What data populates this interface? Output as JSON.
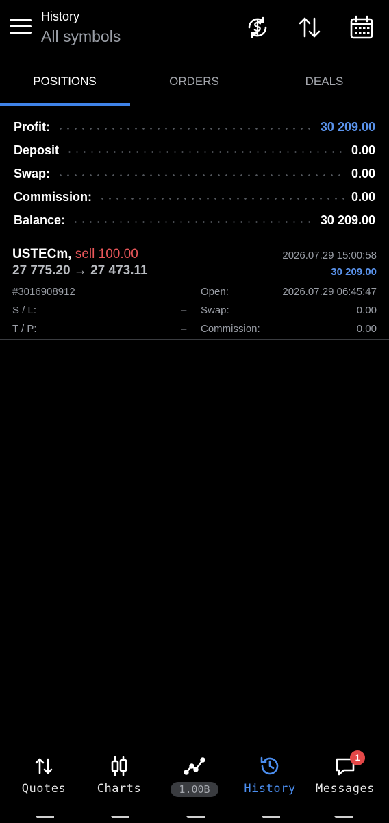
{
  "header": {
    "title": "History",
    "subtitle": "All symbols",
    "icons": [
      "currency-refresh-icon",
      "sort-icon",
      "calendar-icon"
    ]
  },
  "tabs": [
    {
      "label": "POSITIONS",
      "active": true
    },
    {
      "label": "ORDERS",
      "active": false
    },
    {
      "label": "DEALS",
      "active": false
    }
  ],
  "summary": [
    {
      "label": "Profit:",
      "value": "30 209.00",
      "highlight": true
    },
    {
      "label": "Deposit",
      "value": "0.00",
      "highlight": false
    },
    {
      "label": "Swap:",
      "value": "0.00",
      "highlight": false
    },
    {
      "label": "Commission:",
      "value": "0.00",
      "highlight": false
    },
    {
      "label": "Balance:",
      "value": "30 209.00",
      "highlight": false
    }
  ],
  "position": {
    "symbol": "USTECm,",
    "side": "sell 100.00",
    "close_time": "2026.07.29 15:00:58",
    "prices": "27 775.20 → 27 473.11",
    "profit": "30 209.00",
    "ticket": "#3016908912",
    "sl_label": "S / L:",
    "sl_value": "–",
    "tp_label": "T / P:",
    "tp_value": "–",
    "open_label": "Open:",
    "open_value": "2026.07.29 06:45:47",
    "swap_label": "Swap:",
    "swap_value": "0.00",
    "commission_label": "Commission:",
    "commission_value": "0.00"
  },
  "nav": {
    "quotes": "Quotes",
    "charts": "Charts",
    "trade": "1.00B",
    "history": "History",
    "messages": "Messages",
    "messages_badge": "1"
  },
  "colors": {
    "accent": "#3f83e8",
    "profit": "#5a93ec",
    "sell": "#e9575a",
    "badge": "#e44848"
  }
}
